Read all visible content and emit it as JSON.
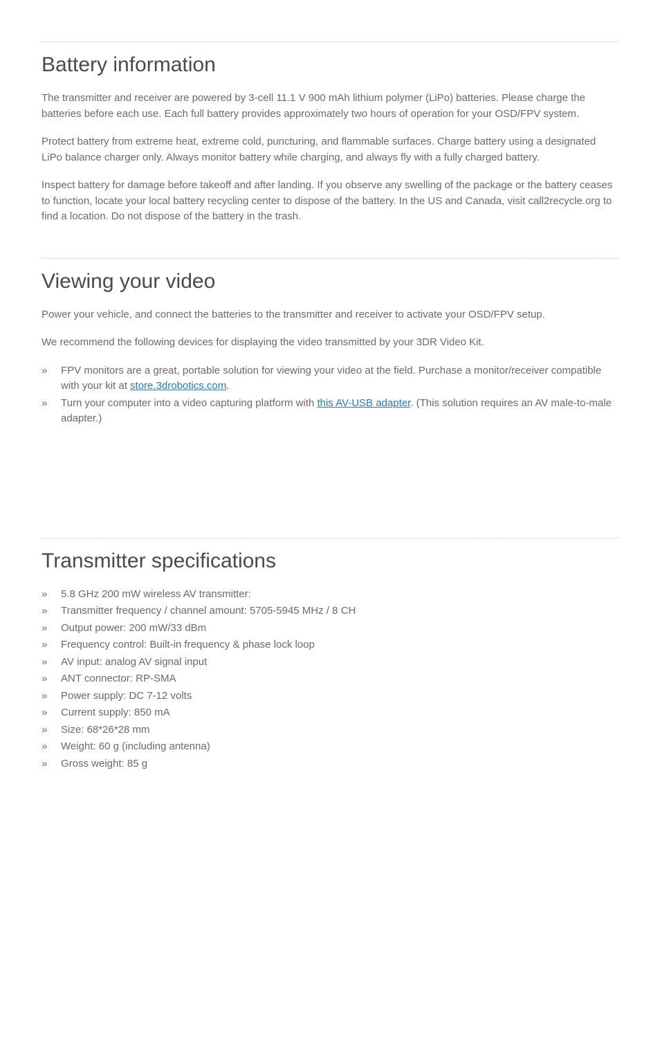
{
  "battery": {
    "title": "Battery information",
    "para1": "The transmitter and receiver are powered by 3-cell 11.1 V 900 mAh lithium polymer (LiPo) batteries. Please charge the batteries before each use. Each full battery provides approximately two hours of operation for your OSD/FPV system.",
    "para2": "Protect battery from extreme heat, extreme cold, puncturing, and flammable surfaces. Charge battery using a designated LiPo balance charger only. Always monitor battery while charging, and always fly with a fully charged battery.",
    "para3": "Inspect battery for damage before takeoff and after landing. If you observe any swelling of the package or the battery ceases to function, locate your local battery recycling center to dispose of the battery.  In the US and Canada, visit call2recycle.org to find a location. Do not dispose of the battery in the trash."
  },
  "viewing": {
    "title": "Viewing your video",
    "para1": "Power your vehicle, and connect the batteries to the transmitter and receiver to activate your OSD/FPV setup.",
    "para2": "We recommend the following devices for displaying the video transmitted by your 3DR Video Kit.",
    "bullet1_pre": "FPV monitors are a great, portable solution for viewing your video at the field. Purchase a monitor/receiver compatible with your kit at ",
    "bullet1_link": "store.3drobotics.com",
    "bullet1_post": ".",
    "bullet2_pre": "Turn your computer into a video capturing platform with ",
    "bullet2_link": "this AV-USB adapter",
    "bullet2_post": ". (This solution requires an AV male-to-male adapter.)"
  },
  "transmitter": {
    "title": "Transmitter specifications",
    "specs": [
      "5.8 GHz 200 mW wireless AV transmitter:",
      "Transmitter frequency / channel amount: 5705-5945 MHz / 8 CH",
      "Output power: 200 mW/33 dBm",
      "Frequency control: Built-in frequency & phase lock loop",
      "AV input: analog AV signal input",
      "ANT connector: RP-SMA",
      "Power supply: DC 7-12 volts",
      "Current supply: 850 mA",
      "Size: 68*26*28 mm",
      "Weight: 60 g (including antenna)",
      "Gross weight: 85 g"
    ]
  }
}
